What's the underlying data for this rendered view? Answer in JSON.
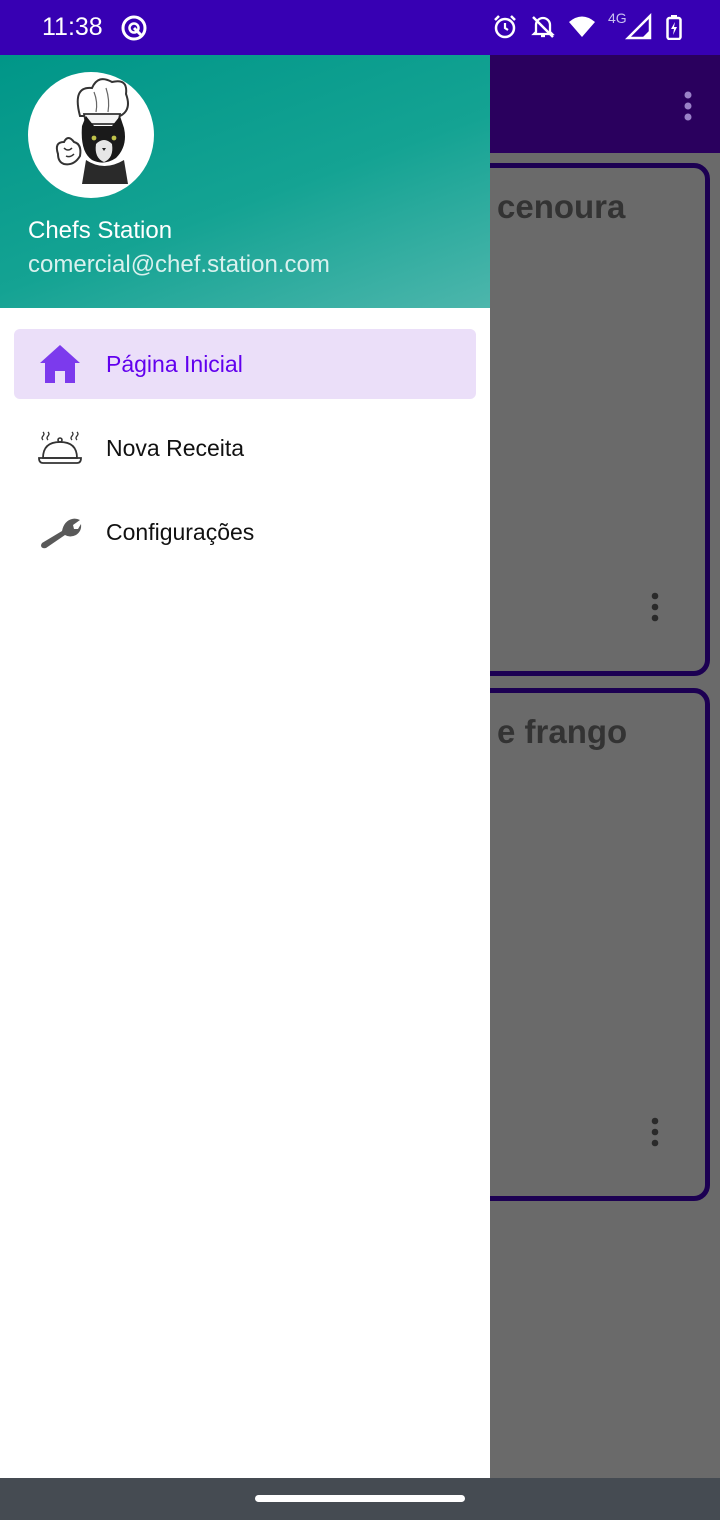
{
  "status_bar": {
    "time": "11:38",
    "network": "4G",
    "icons": [
      "app-notification-icon",
      "alarm-icon",
      "notifications-off-icon",
      "wifi-icon",
      "cell-signal-icon",
      "battery-charging-icon"
    ]
  },
  "app": {
    "cards": [
      {
        "title_visible": "cenoura"
      },
      {
        "title_visible": "e frango"
      }
    ]
  },
  "drawer": {
    "user_name": "Chefs Station",
    "user_email": "comercial@chef.station.com",
    "items": [
      {
        "label": "Página Inicial",
        "icon": "home-icon",
        "active": true
      },
      {
        "label": "Nova Receita",
        "icon": "food-cloche-icon",
        "active": false
      },
      {
        "label": "Configurações",
        "icon": "wrench-icon",
        "active": false
      }
    ]
  },
  "colors": {
    "status_bar": "#3700b3",
    "app_bar": "#2a005e",
    "header_gradient_start": "#009688",
    "header_gradient_end": "#4db6ac",
    "active_item_bg": "#ebdff9",
    "active_item_text": "#6200ee"
  }
}
